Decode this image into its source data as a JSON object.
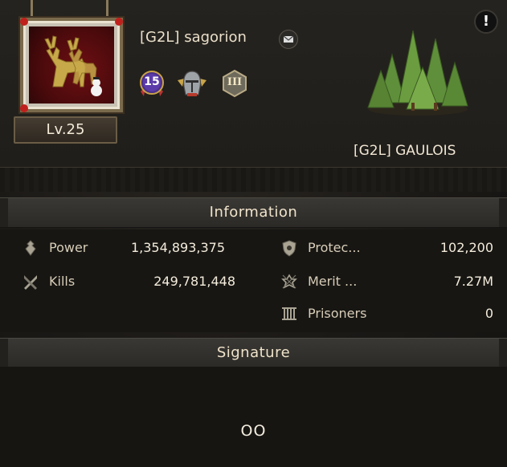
{
  "alert": "!",
  "player": {
    "name": "[G2L] sagorion",
    "level": "Lv.25",
    "badge_number": "15",
    "rank_numeral": "III"
  },
  "alliance": {
    "name": "[G2L] GAULOIS"
  },
  "sections": {
    "information": "Information",
    "signature": "Signature"
  },
  "stats": {
    "power": {
      "label": "Power",
      "value": "1,354,893,375",
      "icon": "power-icon"
    },
    "kills": {
      "label": "Kills",
      "value": "249,781,448",
      "icon": "kills-icon"
    },
    "protection": {
      "label": "Protec...",
      "value": "102,200",
      "icon": "shield-icon"
    },
    "merit": {
      "label": "Merit ...",
      "value": "7.27M",
      "icon": "merit-icon"
    },
    "prisoners": {
      "label": "Prisoners",
      "value": "0",
      "icon": "prison-icon"
    }
  },
  "signature": "OO",
  "colors": {
    "background": "#17150f",
    "accent_text": "#efe3cb",
    "badge_purple": "#5b3ca8"
  }
}
